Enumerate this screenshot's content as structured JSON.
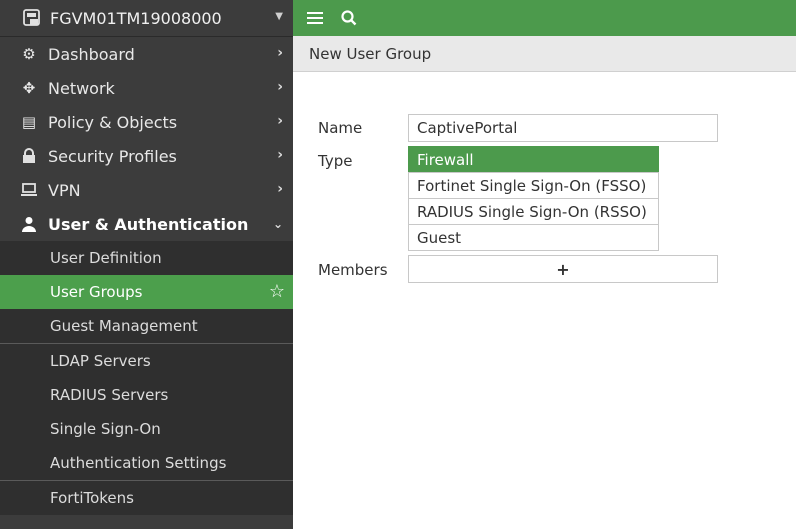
{
  "sidebar": {
    "device_name": "FGVM01TM19008000",
    "nav": [
      {
        "label": "Dashboard",
        "icon": "dashboard-icon"
      },
      {
        "label": "Network",
        "icon": "network-icon"
      },
      {
        "label": "Policy & Objects",
        "icon": "policy-icon"
      },
      {
        "label": "Security Profiles",
        "icon": "lock-icon"
      },
      {
        "label": "VPN",
        "icon": "laptop-icon"
      },
      {
        "label": "User & Authentication",
        "icon": "user-icon"
      }
    ],
    "sub": [
      {
        "label": "User Definition"
      },
      {
        "label": "User Groups"
      },
      {
        "label": "Guest Management"
      },
      {
        "label": "LDAP Servers"
      },
      {
        "label": "RADIUS Servers"
      },
      {
        "label": "Single Sign-On"
      },
      {
        "label": "Authentication Settings"
      },
      {
        "label": "FortiTokens"
      }
    ]
  },
  "topbar": {
    "menu_icon": "hamburger-icon",
    "search_icon": "search-icon"
  },
  "breadcrumb": "New User Group",
  "form": {
    "name_label": "Name",
    "name_value": "CaptivePortal",
    "type_label": "Type",
    "type_options": [
      "Firewall",
      "Fortinet Single Sign-On (FSSO)",
      "RADIUS Single Sign-On (RSSO)",
      "Guest"
    ],
    "type_selected": "Firewall",
    "members_label": "Members",
    "members_add": "+"
  },
  "colors": {
    "accent": "#4c9a4c",
    "sidebar": "#3c3c3c"
  }
}
